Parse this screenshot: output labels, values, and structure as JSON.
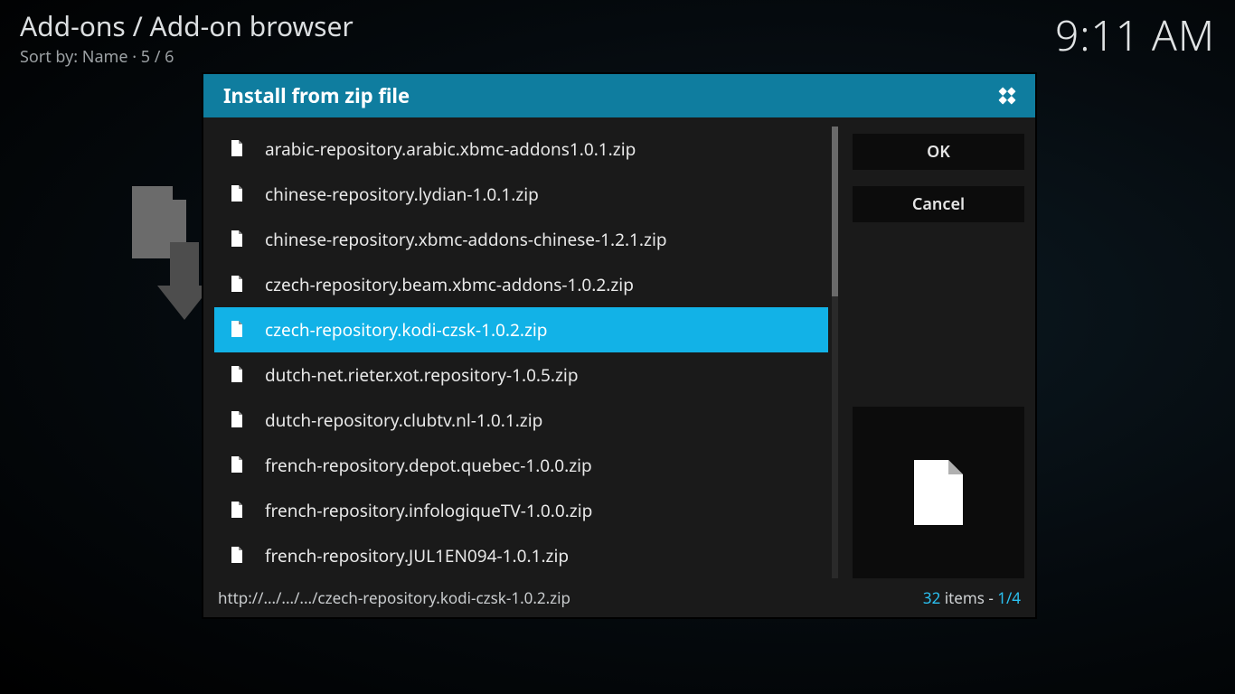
{
  "header": {
    "breadcrumb": "Add-ons / Add-on browser",
    "sort_prefix": "Sort by: Name",
    "sort_sep": " · ",
    "sort_pos": "5 / 6",
    "clock": "9:11 AM"
  },
  "dialog": {
    "title": "Install from zip file",
    "buttons": {
      "ok": "OK",
      "cancel": "Cancel"
    },
    "selected_index": 4,
    "files": [
      "arabic-repository.arabic.xbmc-addons1.0.1.zip",
      "chinese-repository.lydian-1.0.1.zip",
      "chinese-repository.xbmc-addons-chinese-1.2.1.zip",
      "czech-repository.beam.xbmc-addons-1.0.2.zip",
      "czech-repository.kodi-czsk-1.0.2.zip",
      "dutch-net.rieter.xot.repository-1.0.5.zip",
      "dutch-repository.clubtv.nl-1.0.1.zip",
      "french-repository.depot.quebec-1.0.0.zip",
      "french-repository.infologiqueTV-1.0.0.zip",
      "french-repository.JUL1EN094-1.0.1.zip"
    ],
    "footer_path": "http://.../.../.../czech-repository.kodi-czsk-1.0.2.zip",
    "footer_count_num": "32",
    "footer_count_word": " items - ",
    "footer_count_page": "1/4"
  }
}
